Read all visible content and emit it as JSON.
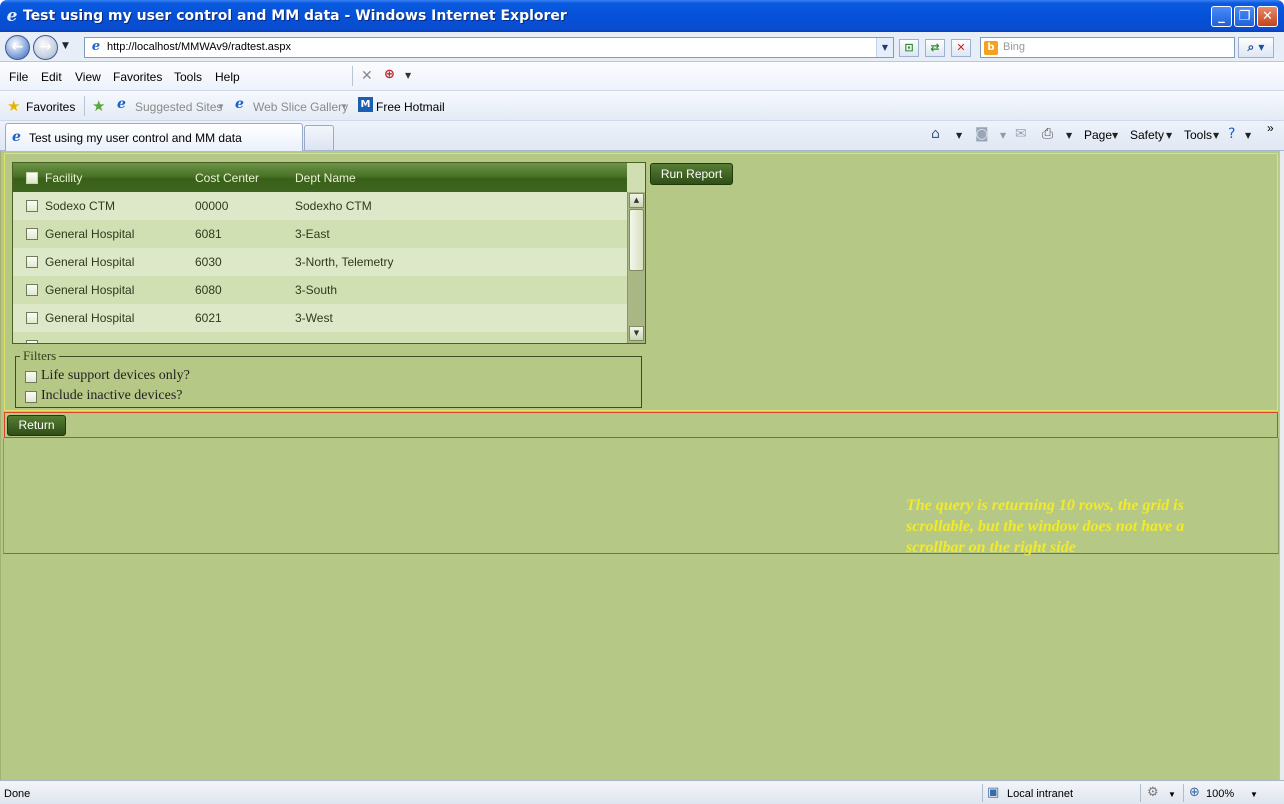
{
  "window": {
    "title": "Test using my user control and MM data - Windows Internet Explorer",
    "controls": {
      "minimize": "_",
      "maximize": "❐",
      "close": "✕"
    }
  },
  "address_bar": {
    "url": "http://localhost/MMWAv9/radtest.aspx",
    "search_placeholder": "Bing",
    "icons": [
      "back-icon",
      "forward-icon",
      "compatibility-icon",
      "refresh-icon",
      "stop-icon",
      "search-icon"
    ]
  },
  "menu": {
    "file": "File",
    "edit": "Edit",
    "view": "View",
    "favorites": "Favorites",
    "tools": "Tools",
    "help": "Help"
  },
  "favorites_bar": {
    "favorites": "Favorites",
    "suggested_sites": "Suggested Sites",
    "web_slice_gallery": "Web Slice Gallery",
    "free_hotmail": "Free Hotmail"
  },
  "tab": {
    "label": "Test using my user control and MM data"
  },
  "command_bar": {
    "page": "Page",
    "safety": "Safety",
    "tools": "Tools"
  },
  "grid": {
    "columns": [
      "Facility",
      "Cost Center",
      "Dept Name"
    ],
    "rows": [
      {
        "facility": "Sodexo CTM",
        "cost_center": "00000",
        "dept": "Sodexho CTM"
      },
      {
        "facility": "General Hospital",
        "cost_center": "6081",
        "dept": "3-East"
      },
      {
        "facility": "General Hospital",
        "cost_center": "6030",
        "dept": "3-North, Telemetry"
      },
      {
        "facility": "General Hospital",
        "cost_center": "6080",
        "dept": "3-South"
      },
      {
        "facility": "General Hospital",
        "cost_center": "6021",
        "dept": "3-West"
      }
    ]
  },
  "buttons": {
    "run_report": "Run Report",
    "return": "Return"
  },
  "filters": {
    "legend": "Filters",
    "life_support": "Life support devices only?",
    "include_inactive": "Include inactive devices?"
  },
  "note": "The query is returning 10 rows, the grid is scrollable, but the window does not have a scrollbar on the right side",
  "status_bar": {
    "status": "Done",
    "zone": "Local intranet",
    "zoom": "100%"
  },
  "colors": {
    "page_background": "#b6c885",
    "grid_header": "#4a7228",
    "button": "#2f4f16",
    "note_text": "#f2ea2a",
    "return_border": "#d7452e"
  }
}
